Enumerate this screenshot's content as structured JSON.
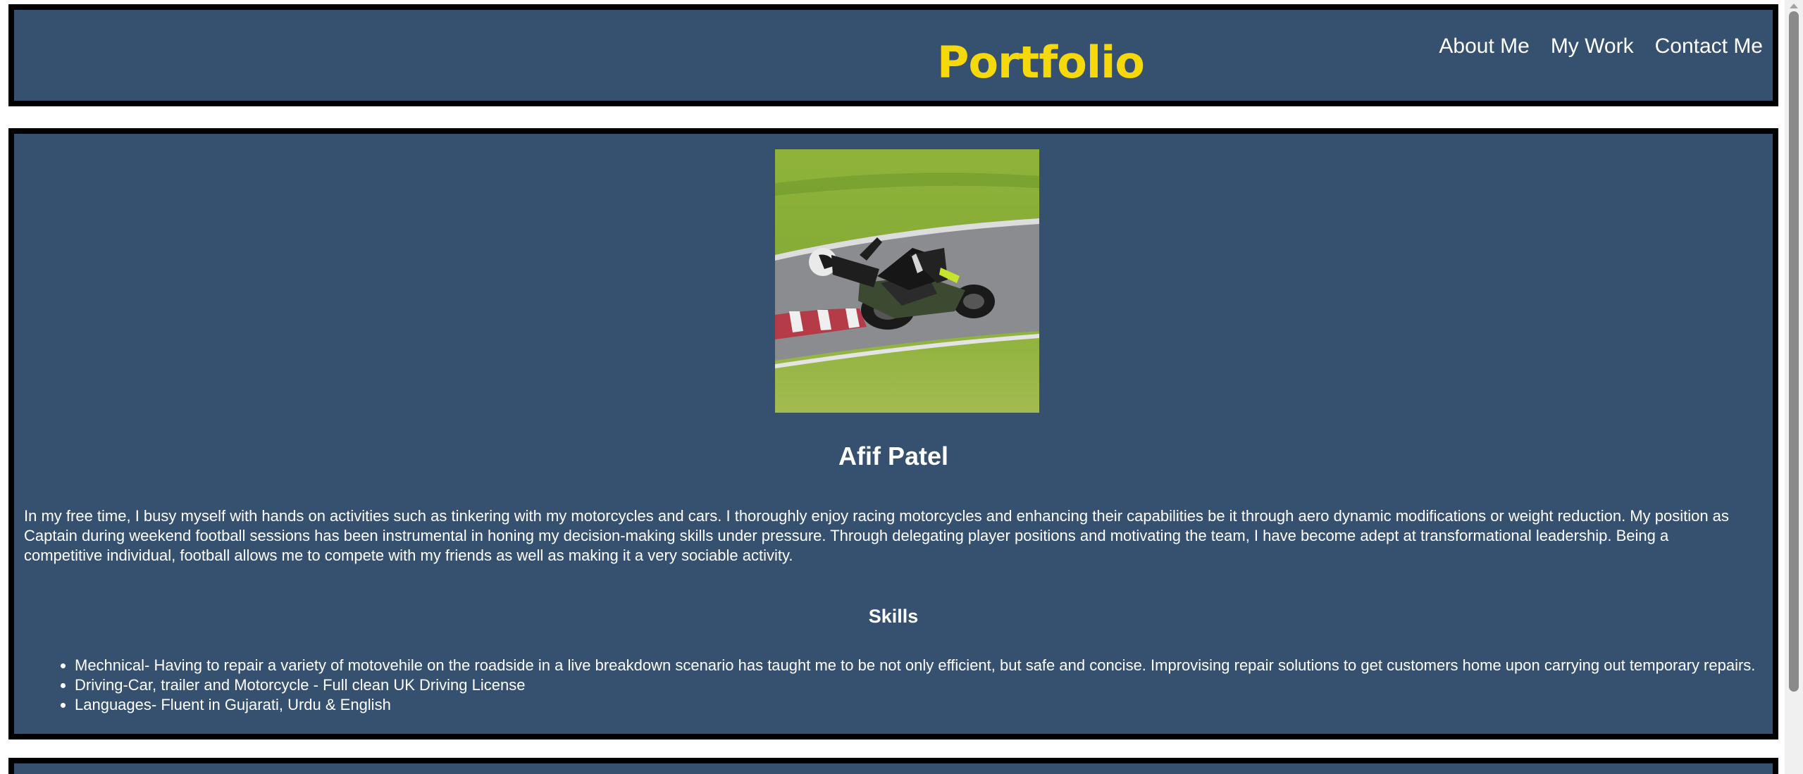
{
  "header": {
    "title": "Portfolio",
    "nav": {
      "about": "About Me",
      "work": "My Work",
      "contact": "Contact Me"
    }
  },
  "about": {
    "photo_alt": "Motorcycle rider leaning into a corner on a race track",
    "name": "Afif Patel",
    "bio": "In my free time, I busy myself with hands on activities such as tinkering with my motorcycles and cars. I thoroughly enjoy racing motorcycles and enhancing their capabilities be it through aero dynamic modifications or weight reduction. My position as Captain during weekend football sessions has been instrumental in honing my decision-making skills under pressure. Through delegating player positions and motivating the team, I have become adept at transformational leadership. Being a competitive individual, football allows me to compete with my friends as well as making it a very sociable activity.",
    "skills_title": "Skills",
    "skills": [
      "Mechnical- Having to repair a variety of motovehile on the roadside in a live breakdown scenario has taught me to be not only efficient, but safe and concise. Improvising repair solutions to get customers home upon carrying out temporary repairs.",
      "Driving-Car, trailer and Motorcycle - Full clean UK Driving License",
      "Languages- Fluent in Gujarati, Urdu & English"
    ]
  },
  "colors": {
    "panel_bg": "#36506f",
    "border": "#000000",
    "title": "#f5d90a",
    "text": "#ffffff"
  }
}
